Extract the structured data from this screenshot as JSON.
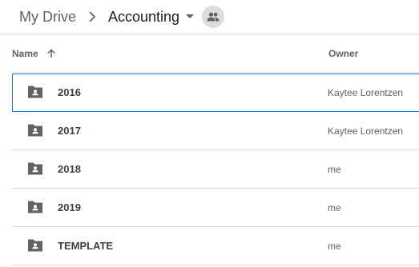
{
  "breadcrumb": {
    "root": "My Drive",
    "current": "Accounting",
    "separator_icon": "chevron-right-icon",
    "dropdown_icon": "caret-down-icon",
    "shared_icon": "people-icon"
  },
  "columns": {
    "name": "Name",
    "owner": "Owner",
    "sort": "ascending"
  },
  "files": [
    {
      "name": "2016",
      "owner": "Kaytee Lorentzen",
      "icon": "shared-folder-icon",
      "selected": true
    },
    {
      "name": "2017",
      "owner": "Kaytee Lorentzen",
      "icon": "shared-folder-icon",
      "selected": false
    },
    {
      "name": "2018",
      "owner": "me",
      "icon": "shared-folder-icon",
      "selected": false
    },
    {
      "name": "2019",
      "owner": "me",
      "icon": "shared-folder-icon",
      "selected": false
    },
    {
      "name": "TEMPLATE",
      "owner": "me",
      "icon": "shared-folder-icon",
      "selected": false
    }
  ],
  "colors": {
    "selection_border": "#1a73e8",
    "icon_gray": "#5f6368",
    "divider": "#dadce0"
  }
}
